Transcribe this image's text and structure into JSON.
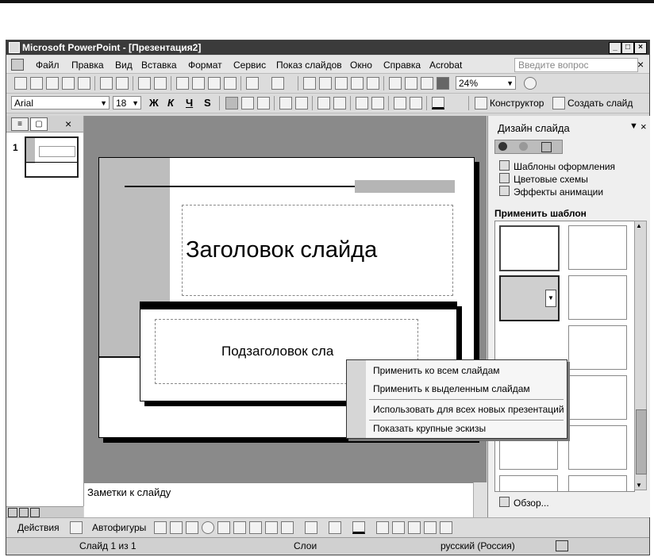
{
  "window": {
    "title": "Microsoft PowerPoint - [Презентация2]",
    "controls": [
      "_",
      "□",
      "×"
    ]
  },
  "menu": {
    "items": [
      "Файл",
      "Правка",
      "Вид",
      "Вставка",
      "Формат",
      "Сервис",
      "Показ слайдов",
      "Окно",
      "Справка",
      "Acrobat"
    ],
    "ask_placeholder": "Введите вопрос",
    "close": "×"
  },
  "standard_toolbar": {
    "zoom": "24%"
  },
  "formatting_toolbar": {
    "font": "Arial",
    "size": "18",
    "bold": "Ж",
    "italic": "К",
    "underline": "Ч",
    "shadow": "S",
    "designer_label": "Конструктор",
    "new_slide_label": "Создать слайд"
  },
  "left_pane": {
    "close": "×",
    "slide_number": "1"
  },
  "slide": {
    "title": "Заголовок слайда",
    "subtitle": "Подзаголовок сла"
  },
  "notes": {
    "placeholder": "Заметки к слайду"
  },
  "task_pane": {
    "title": "Дизайн слайда",
    "links": [
      "Шаблоны оформления",
      "Цветовые схемы",
      "Эффекты анимации"
    ],
    "apply_heading": "Применить шаблон оформления:",
    "browse": "Обзор..."
  },
  "context_menu": {
    "items": [
      "Применить ко всем слайдам",
      "Применить к выделенным слайдам",
      "Использовать для всех новых презентаций",
      "Показать крупные эскизы"
    ]
  },
  "drawing_toolbar": {
    "actions": "Действия",
    "autoshapes": "Автофигуры"
  },
  "status": {
    "slide": "Слайд 1 из 1",
    "design": "Слои",
    "language": "русский (Россия)"
  }
}
